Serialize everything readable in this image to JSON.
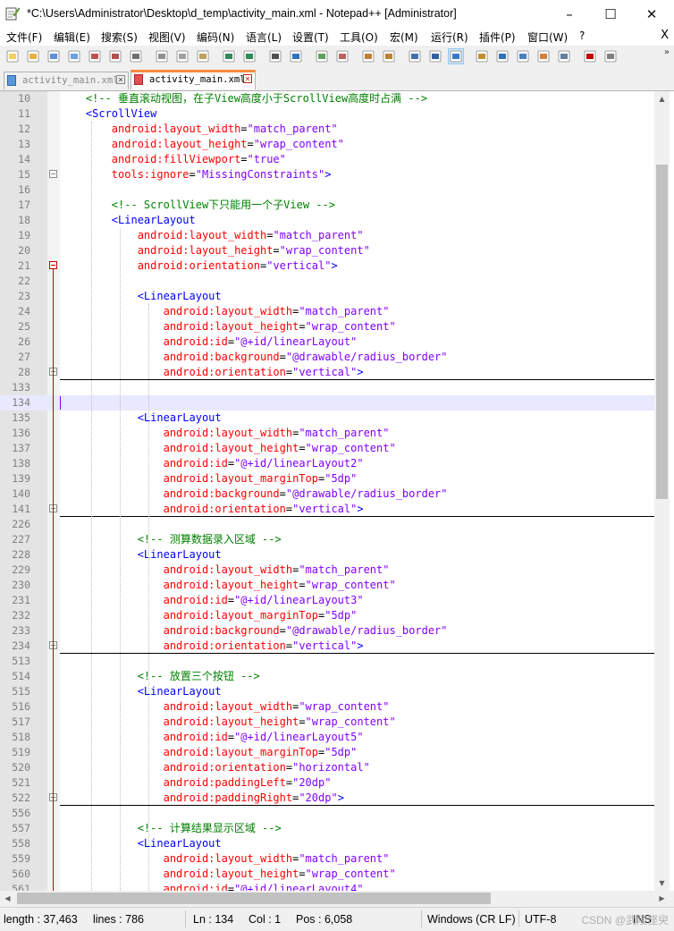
{
  "window": {
    "title": "*C:\\Users\\Administrator\\Desktop\\d_temp\\activity_main.xml - Notepad++ [Administrator]",
    "minimize": "–",
    "maximize": "☐",
    "close": "✕"
  },
  "menu": {
    "items": [
      "文件(F)",
      "编辑(E)",
      "搜索(S)",
      "视图(V)",
      "编码(N)",
      "语言(L)",
      "设置(T)",
      "工具(O)",
      "宏(M)",
      "运行(R)",
      "插件(P)",
      "窗口(W)",
      "?"
    ],
    "close": "X"
  },
  "toolbar": {
    "more": "»",
    "icons": [
      "new-file-icon",
      "open-file-icon",
      "save-icon",
      "save-all-icon",
      "close-icon",
      "close-all-icon",
      "print-icon",
      "cut-icon",
      "copy-icon",
      "paste-icon",
      "undo-icon",
      "redo-icon",
      "find-icon",
      "replace-icon",
      "zoom-in-icon",
      "zoom-out-icon",
      "sync-vertical-icon",
      "sync-horizontal-icon",
      "word-wrap-icon",
      "show-all-chars-icon",
      "indent-guide-icon",
      "user-language-icon",
      "document-map-icon",
      "function-list-icon",
      "folder-workspace-icon",
      "monitoring-icon",
      "start-recording-icon",
      "stop-recording-icon"
    ]
  },
  "tabs": [
    {
      "label": "activity_main.xml",
      "active": false
    },
    {
      "label": "activity_main.xml",
      "active": true
    }
  ],
  "editor": {
    "current_line": "134",
    "lines": [
      {
        "n": "10",
        "indent": 1,
        "tokens": [
          {
            "t": "com",
            "v": "<!-- 垂直滚动视图，在子View高度小于ScrollView高度时占满 -->"
          }
        ]
      },
      {
        "n": "11",
        "indent": 1,
        "tokens": [
          {
            "t": "tag",
            "v": "<ScrollView"
          }
        ]
      },
      {
        "n": "12",
        "indent": 2,
        "tokens": [
          {
            "t": "attr",
            "v": "android:layout_width"
          },
          {
            "t": "eq",
            "v": "="
          },
          {
            "t": "val",
            "v": "\"match_parent\""
          }
        ]
      },
      {
        "n": "13",
        "indent": 2,
        "tokens": [
          {
            "t": "attr",
            "v": "android:layout_height"
          },
          {
            "t": "eq",
            "v": "="
          },
          {
            "t": "val",
            "v": "\"wrap_content\""
          }
        ]
      },
      {
        "n": "14",
        "indent": 2,
        "tokens": [
          {
            "t": "attr",
            "v": "android:fillViewport"
          },
          {
            "t": "eq",
            "v": "="
          },
          {
            "t": "val",
            "v": "\"true\""
          }
        ]
      },
      {
        "n": "15",
        "indent": 2,
        "fold": "minus",
        "tokens": [
          {
            "t": "attr",
            "v": "tools:ignore"
          },
          {
            "t": "eq",
            "v": "="
          },
          {
            "t": "val",
            "v": "\"MissingConstraints\""
          },
          {
            "t": "tag",
            "v": ">"
          }
        ]
      },
      {
        "n": "16",
        "indent": 0,
        "tokens": []
      },
      {
        "n": "17",
        "indent": 2,
        "tokens": [
          {
            "t": "com",
            "v": "<!-- ScrollView下只能用一个子View -->"
          }
        ]
      },
      {
        "n": "18",
        "indent": 2,
        "tokens": [
          {
            "t": "tag",
            "v": "<LinearLayout"
          }
        ]
      },
      {
        "n": "19",
        "indent": 3,
        "tokens": [
          {
            "t": "attr",
            "v": "android:layout_width"
          },
          {
            "t": "eq",
            "v": "="
          },
          {
            "t": "val",
            "v": "\"match_parent\""
          }
        ]
      },
      {
        "n": "20",
        "indent": 3,
        "tokens": [
          {
            "t": "attr",
            "v": "android:layout_height"
          },
          {
            "t": "eq",
            "v": "="
          },
          {
            "t": "val",
            "v": "\"wrap_content\""
          }
        ]
      },
      {
        "n": "21",
        "indent": 3,
        "fold": "minus-red",
        "tokens": [
          {
            "t": "attr",
            "v": "android:orientation"
          },
          {
            "t": "eq",
            "v": "="
          },
          {
            "t": "val",
            "v": "\"vertical\""
          },
          {
            "t": "tag",
            "v": ">"
          }
        ]
      },
      {
        "n": "22",
        "indent": 0,
        "tokens": []
      },
      {
        "n": "23",
        "indent": 3,
        "tokens": [
          {
            "t": "tag",
            "v": "<LinearLayout"
          }
        ]
      },
      {
        "n": "24",
        "indent": 4,
        "tokens": [
          {
            "t": "attr",
            "v": "android:layout_width"
          },
          {
            "t": "eq",
            "v": "="
          },
          {
            "t": "val",
            "v": "\"match_parent\""
          }
        ]
      },
      {
        "n": "25",
        "indent": 4,
        "tokens": [
          {
            "t": "attr",
            "v": "android:layout_height"
          },
          {
            "t": "eq",
            "v": "="
          },
          {
            "t": "val",
            "v": "\"wrap_content\""
          }
        ]
      },
      {
        "n": "26",
        "indent": 4,
        "tokens": [
          {
            "t": "attr",
            "v": "android:id"
          },
          {
            "t": "eq",
            "v": "="
          },
          {
            "t": "val",
            "v": "\"@+id/linearLayout\""
          }
        ]
      },
      {
        "n": "27",
        "indent": 4,
        "tokens": [
          {
            "t": "attr",
            "v": "android:background"
          },
          {
            "t": "eq",
            "v": "="
          },
          {
            "t": "val",
            "v": "\"@drawable/radius_border\""
          }
        ]
      },
      {
        "n": "28",
        "indent": 4,
        "fold": "plus",
        "tokens": [
          {
            "t": "attr",
            "v": "android:orientation"
          },
          {
            "t": "eq",
            "v": "="
          },
          {
            "t": "val",
            "v": "\"vertical\""
          },
          {
            "t": "tag",
            "v": ">"
          }
        ]
      },
      {
        "n": "133",
        "indent": 0,
        "tokens": []
      },
      {
        "n": "134",
        "indent": 0,
        "tokens": []
      },
      {
        "n": "135",
        "indent": 3,
        "tokens": [
          {
            "t": "tag",
            "v": "<LinearLayout"
          }
        ]
      },
      {
        "n": "136",
        "indent": 4,
        "tokens": [
          {
            "t": "attr",
            "v": "android:layout_width"
          },
          {
            "t": "eq",
            "v": "="
          },
          {
            "t": "val",
            "v": "\"match_parent\""
          }
        ]
      },
      {
        "n": "137",
        "indent": 4,
        "tokens": [
          {
            "t": "attr",
            "v": "android:layout_height"
          },
          {
            "t": "eq",
            "v": "="
          },
          {
            "t": "val",
            "v": "\"wrap_content\""
          }
        ]
      },
      {
        "n": "138",
        "indent": 4,
        "tokens": [
          {
            "t": "attr",
            "v": "android:id"
          },
          {
            "t": "eq",
            "v": "="
          },
          {
            "t": "val",
            "v": "\"@+id/linearLayout2\""
          }
        ]
      },
      {
        "n": "139",
        "indent": 4,
        "tokens": [
          {
            "t": "attr",
            "v": "android:layout_marginTop"
          },
          {
            "t": "eq",
            "v": "="
          },
          {
            "t": "val",
            "v": "\"5dp\""
          }
        ]
      },
      {
        "n": "140",
        "indent": 4,
        "tokens": [
          {
            "t": "attr",
            "v": "android:background"
          },
          {
            "t": "eq",
            "v": "="
          },
          {
            "t": "val",
            "v": "\"@drawable/radius_border\""
          }
        ]
      },
      {
        "n": "141",
        "indent": 4,
        "fold": "plus",
        "tokens": [
          {
            "t": "attr",
            "v": "android:orientation"
          },
          {
            "t": "eq",
            "v": "="
          },
          {
            "t": "val",
            "v": "\"vertical\""
          },
          {
            "t": "tag",
            "v": ">"
          }
        ]
      },
      {
        "n": "226",
        "indent": 0,
        "tokens": []
      },
      {
        "n": "227",
        "indent": 3,
        "tokens": [
          {
            "t": "com",
            "v": "<!-- 测算数据录入区域 -->"
          }
        ]
      },
      {
        "n": "228",
        "indent": 3,
        "tokens": [
          {
            "t": "tag",
            "v": "<LinearLayout"
          }
        ]
      },
      {
        "n": "229",
        "indent": 4,
        "tokens": [
          {
            "t": "attr",
            "v": "android:layout_width"
          },
          {
            "t": "eq",
            "v": "="
          },
          {
            "t": "val",
            "v": "\"match_parent\""
          }
        ]
      },
      {
        "n": "230",
        "indent": 4,
        "tokens": [
          {
            "t": "attr",
            "v": "android:layout_height"
          },
          {
            "t": "eq",
            "v": "="
          },
          {
            "t": "val",
            "v": "\"wrap_content\""
          }
        ]
      },
      {
        "n": "231",
        "indent": 4,
        "tokens": [
          {
            "t": "attr",
            "v": "android:id"
          },
          {
            "t": "eq",
            "v": "="
          },
          {
            "t": "val",
            "v": "\"@+id/linearLayout3\""
          }
        ]
      },
      {
        "n": "232",
        "indent": 4,
        "tokens": [
          {
            "t": "attr",
            "v": "android:layout_marginTop"
          },
          {
            "t": "eq",
            "v": "="
          },
          {
            "t": "val",
            "v": "\"5dp\""
          }
        ]
      },
      {
        "n": "233",
        "indent": 4,
        "tokens": [
          {
            "t": "attr",
            "v": "android:background"
          },
          {
            "t": "eq",
            "v": "="
          },
          {
            "t": "val",
            "v": "\"@drawable/radius_border\""
          }
        ]
      },
      {
        "n": "234",
        "indent": 4,
        "fold": "plus",
        "tokens": [
          {
            "t": "attr",
            "v": "android:orientation"
          },
          {
            "t": "eq",
            "v": "="
          },
          {
            "t": "val",
            "v": "\"vertical\""
          },
          {
            "t": "tag",
            "v": ">"
          }
        ]
      },
      {
        "n": "513",
        "indent": 0,
        "tokens": []
      },
      {
        "n": "514",
        "indent": 3,
        "tokens": [
          {
            "t": "com",
            "v": "<!-- 放置三个按钮 -->"
          }
        ]
      },
      {
        "n": "515",
        "indent": 3,
        "tokens": [
          {
            "t": "tag",
            "v": "<LinearLayout"
          }
        ]
      },
      {
        "n": "516",
        "indent": 4,
        "tokens": [
          {
            "t": "attr",
            "v": "android:layout_width"
          },
          {
            "t": "eq",
            "v": "="
          },
          {
            "t": "val",
            "v": "\"wrap_content\""
          }
        ]
      },
      {
        "n": "517",
        "indent": 4,
        "tokens": [
          {
            "t": "attr",
            "v": "android:layout_height"
          },
          {
            "t": "eq",
            "v": "="
          },
          {
            "t": "val",
            "v": "\"wrap_content\""
          }
        ]
      },
      {
        "n": "518",
        "indent": 4,
        "tokens": [
          {
            "t": "attr",
            "v": "android:id"
          },
          {
            "t": "eq",
            "v": "="
          },
          {
            "t": "val",
            "v": "\"@+id/linearLayout5\""
          }
        ]
      },
      {
        "n": "519",
        "indent": 4,
        "tokens": [
          {
            "t": "attr",
            "v": "android:layout_marginTop"
          },
          {
            "t": "eq",
            "v": "="
          },
          {
            "t": "val",
            "v": "\"5dp\""
          }
        ]
      },
      {
        "n": "520",
        "indent": 4,
        "tokens": [
          {
            "t": "attr",
            "v": "android:orientation"
          },
          {
            "t": "eq",
            "v": "="
          },
          {
            "t": "val",
            "v": "\"horizontal\""
          }
        ]
      },
      {
        "n": "521",
        "indent": 4,
        "tokens": [
          {
            "t": "attr",
            "v": "android:paddingLeft"
          },
          {
            "t": "eq",
            "v": "="
          },
          {
            "t": "val",
            "v": "\"20dp\""
          }
        ]
      },
      {
        "n": "522",
        "indent": 4,
        "fold": "plus",
        "tokens": [
          {
            "t": "attr",
            "v": "android:paddingRight"
          },
          {
            "t": "eq",
            "v": "="
          },
          {
            "t": "val",
            "v": "\"20dp\""
          },
          {
            "t": "tag",
            "v": ">"
          }
        ]
      },
      {
        "n": "556",
        "indent": 0,
        "tokens": []
      },
      {
        "n": "557",
        "indent": 3,
        "tokens": [
          {
            "t": "com",
            "v": "<!-- 计算结果显示区域 -->"
          }
        ]
      },
      {
        "n": "558",
        "indent": 3,
        "tokens": [
          {
            "t": "tag",
            "v": "<LinearLayout"
          }
        ]
      },
      {
        "n": "559",
        "indent": 4,
        "tokens": [
          {
            "t": "attr",
            "v": "android:layout_width"
          },
          {
            "t": "eq",
            "v": "="
          },
          {
            "t": "val",
            "v": "\"match_parent\""
          }
        ]
      },
      {
        "n": "560",
        "indent": 4,
        "tokens": [
          {
            "t": "attr",
            "v": "android:layout_height"
          },
          {
            "t": "eq",
            "v": "="
          },
          {
            "t": "val",
            "v": "\"wrap_content\""
          }
        ]
      },
      {
        "n": "561",
        "indent": 4,
        "tokens": [
          {
            "t": "attr",
            "v": "android:id"
          },
          {
            "t": "eq",
            "v": "="
          },
          {
            "t": "val",
            "v": "\"@+id/linearLayout4\""
          }
        ]
      }
    ]
  },
  "scroll": {
    "up": "▲",
    "down": "▼",
    "left": "◀",
    "right": "▶"
  },
  "status": {
    "length": "length : 37,463",
    "lines": "lines : 786",
    "ln": "Ln : 134",
    "col": "Col : 1",
    "pos": "Pos : 6,058",
    "eol": "Windows (CR LF)",
    "encoding": "UTF-8",
    "mode": "INS",
    "watermark": "CSDN @武陵悭臾"
  },
  "colors": {
    "tag": "#0000ff",
    "attr": "#ff0000",
    "value": "#8000ff",
    "comment": "#008000",
    "active_tab_accent": "#fa8c3c",
    "current_line": "#e8e8ff"
  }
}
